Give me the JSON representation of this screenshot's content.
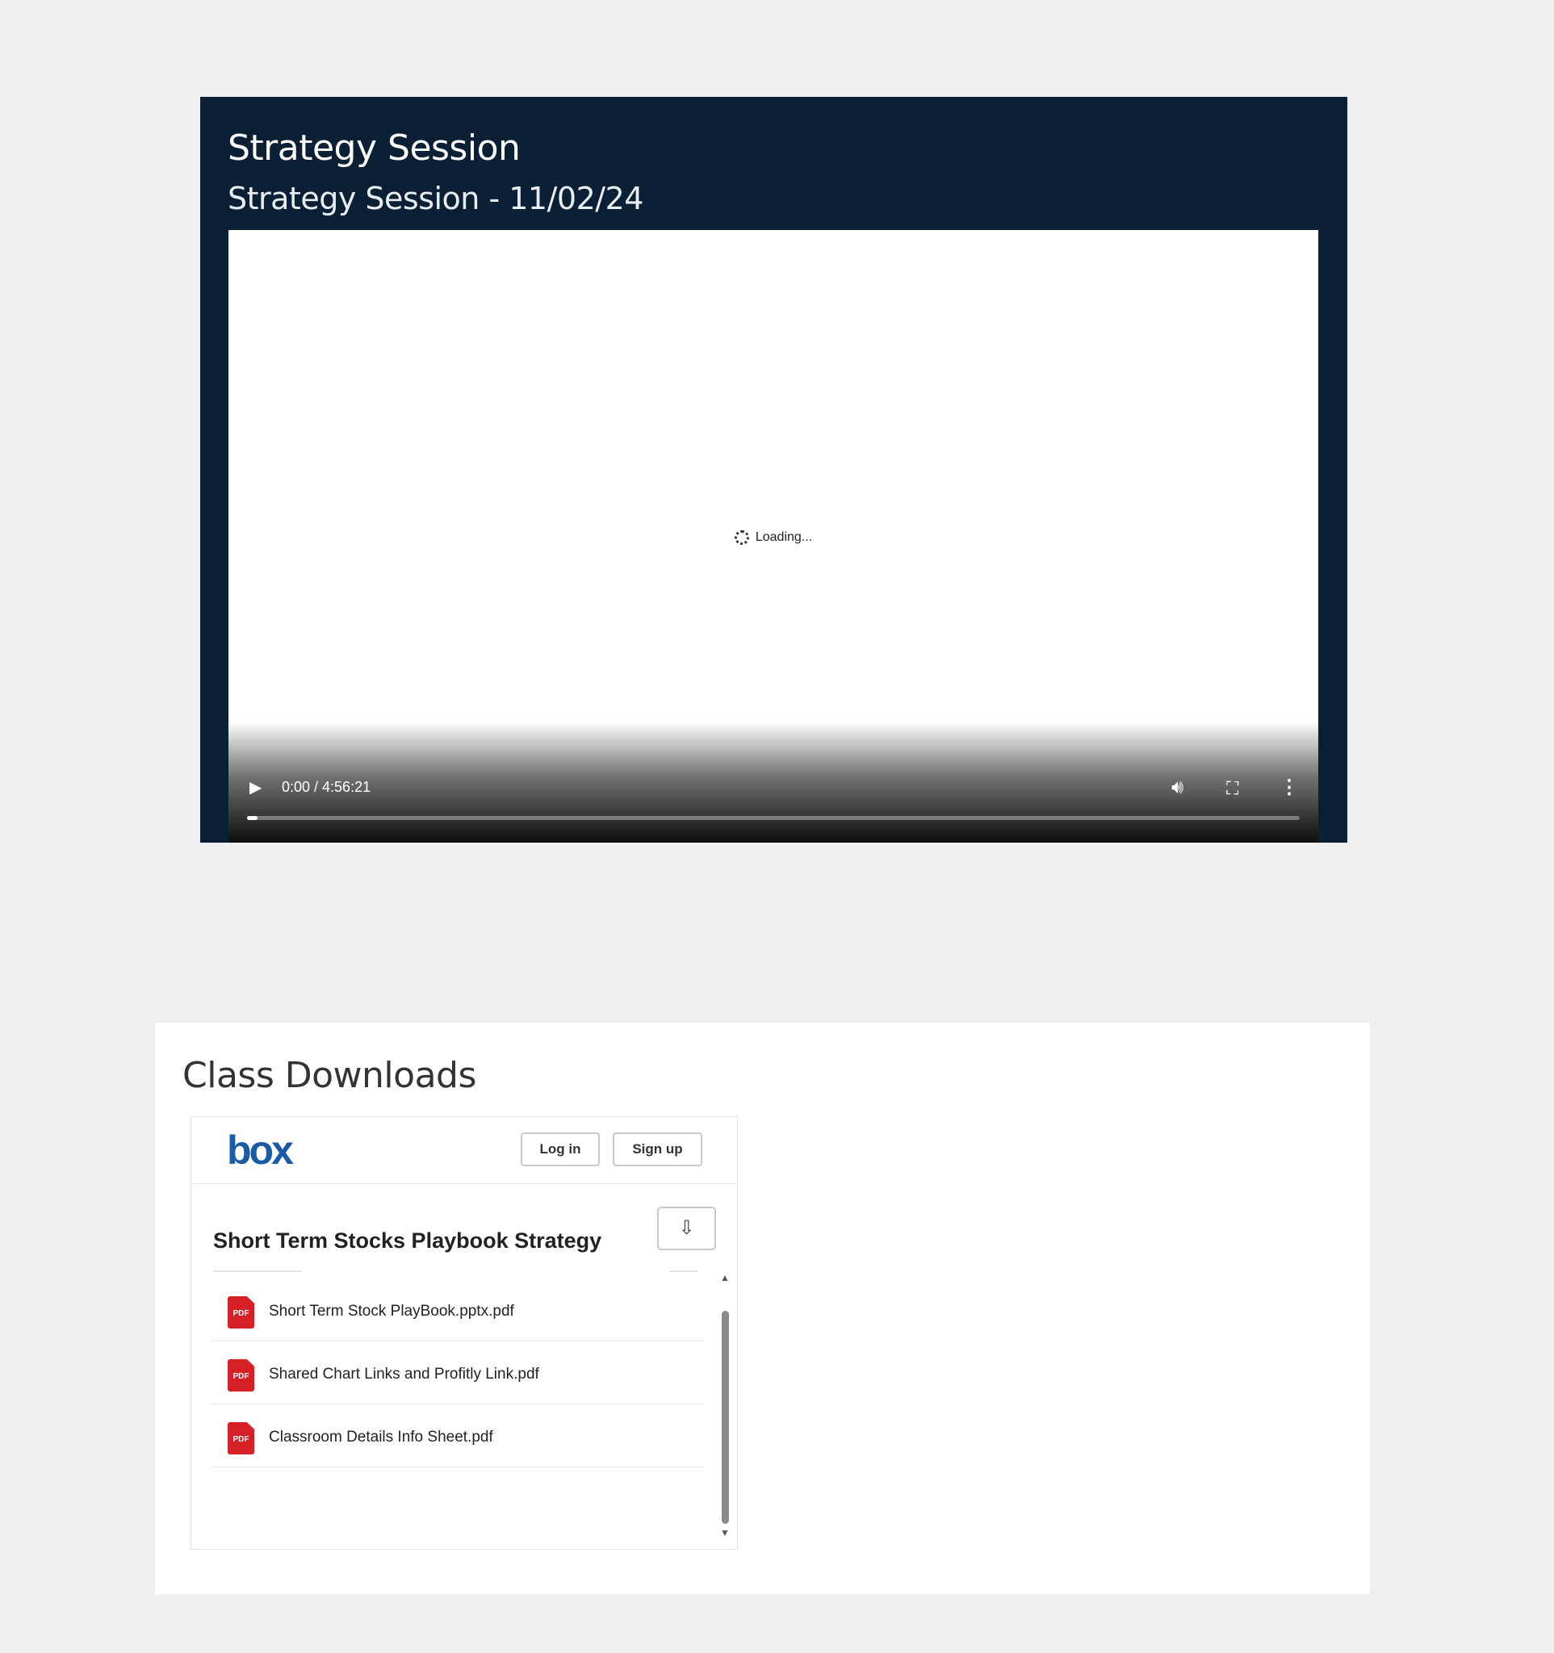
{
  "video": {
    "title": "Strategy Session",
    "subtitle": "Strategy Session - 11/02/24",
    "loading_text": "Loading...",
    "time_display": "0:00 / 4:56:21",
    "progress_fraction": 0.01
  },
  "downloads": {
    "heading": "Class Downloads",
    "box": {
      "logo_text": "box",
      "login_label": "Log in",
      "signup_label": "Sign up",
      "folder_title": "Short Term Stocks Playbook Strategy",
      "files": [
        {
          "name": "Short Term Stock PlayBook.pptx.pdf",
          "type_badge": "PDF"
        },
        {
          "name": "Shared Chart Links and Profitly Link.pdf",
          "type_badge": "PDF"
        },
        {
          "name": "Classroom Details Info Sheet.pdf",
          "type_badge": "PDF"
        }
      ]
    }
  },
  "icons": {
    "play": "play-icon",
    "volume": "volume-icon",
    "fullscreen": "fullscreen-icon",
    "more": "more-options-icon",
    "download": "download-icon",
    "pdf": "pdf-file-icon"
  },
  "colors": {
    "video_card_bg": "#0b2034",
    "box_brand": "#1b5ba6",
    "pdf_red": "#d71f26"
  }
}
